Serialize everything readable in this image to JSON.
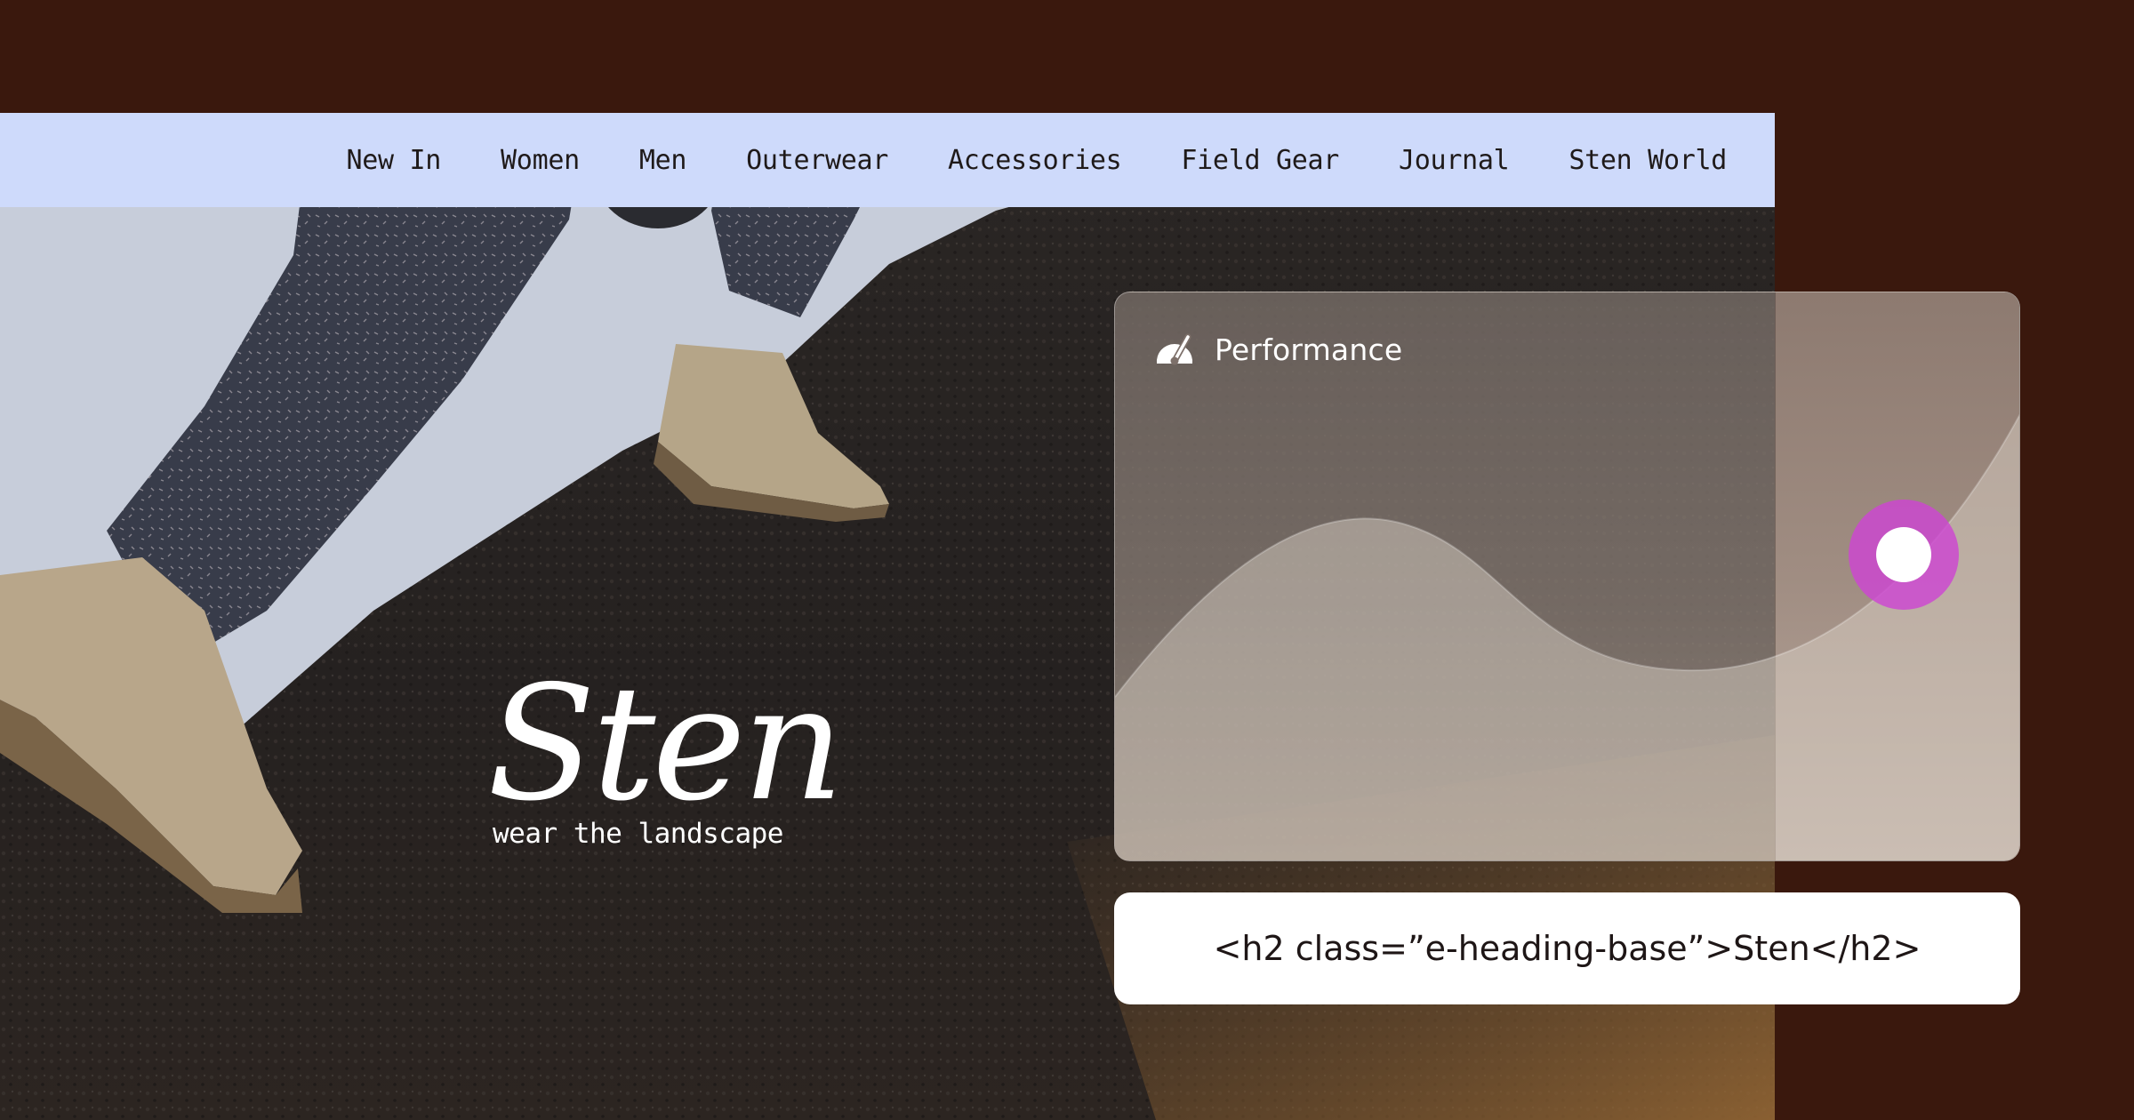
{
  "nav": {
    "items": [
      "New In",
      "Women",
      "Men",
      "Outerwear",
      "Accessories",
      "Field Gear",
      "Journal",
      "Sten World"
    ]
  },
  "brand": {
    "name": "Sten",
    "tagline": "wear the landscape"
  },
  "performance_card": {
    "title": "Performance",
    "icon": "gauge-icon",
    "accent_color": "#cd46d2"
  },
  "code_snippet": {
    "text": "<h2 class=”e-heading-base”>Sten</h2>"
  },
  "colors": {
    "page_background": "#3a180d",
    "nav_background": "#cedafb"
  }
}
